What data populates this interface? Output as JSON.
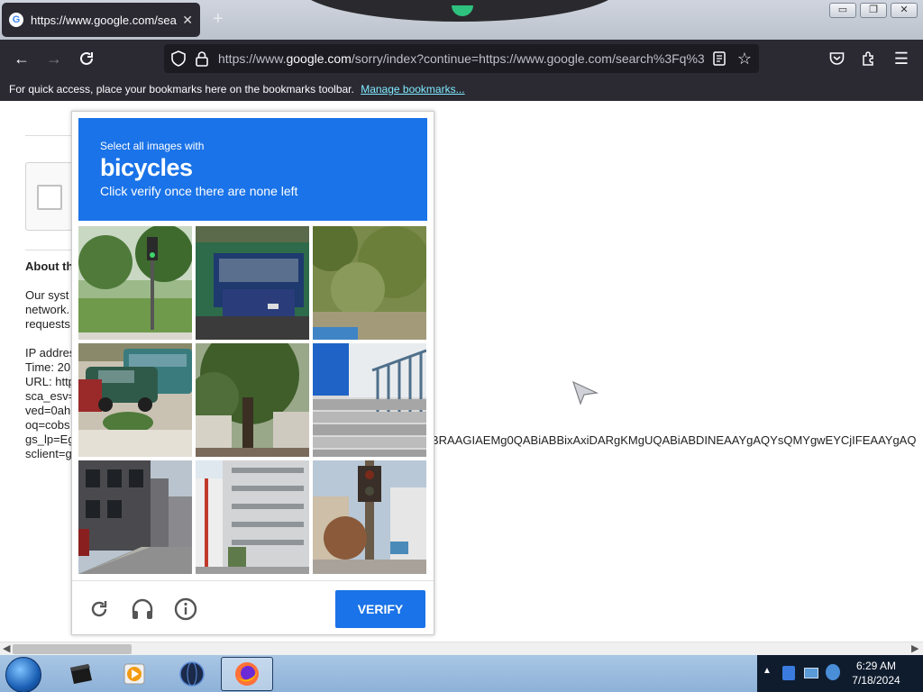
{
  "browser": {
    "tab_title": "https://www.google.com/search",
    "url_domain": "google.com",
    "url_prefix": "https://www.",
    "url_suffix": "/sorry/index?continue=https://www.google.com/search%3Fq%3",
    "bookmarks_text": "For quick access, place your bookmarks here on the bookmarks toolbar.",
    "bookmarks_link": "Manage bookmarks..."
  },
  "page": {
    "about_heading": "About th",
    "lines": [
      "Our syst",
      "network.",
      "requests",
      "",
      "IP addres",
      "Time: 20",
      "URL: http",
      "sca_esv=",
      "ved=0ahU",
      "oq=cobs",
      "gs_lp=Eg",
      "sclient=g"
    ],
    "overflow_text": "BRAAGIAEMg0QABiABBixAxiDARgKMgUQABiABDINEAAYgAQYsQMYgwEYCjIFEAAYgAQ"
  },
  "captcha": {
    "instruction_small": "Select all images with",
    "target": "bicycles",
    "instruction_sub": "Click verify once there are none left",
    "verify_label": "VERIFY",
    "tiles": [
      "park-traffic-light",
      "bus-front",
      "grassy-hillside",
      "parked-cars-van",
      "tree-street",
      "stairs-railing",
      "city-street-buildings",
      "apartment-building",
      "traffic-signal-pole"
    ]
  },
  "taskbar": {
    "time": "6:29 AM",
    "date": "7/18/2024"
  }
}
